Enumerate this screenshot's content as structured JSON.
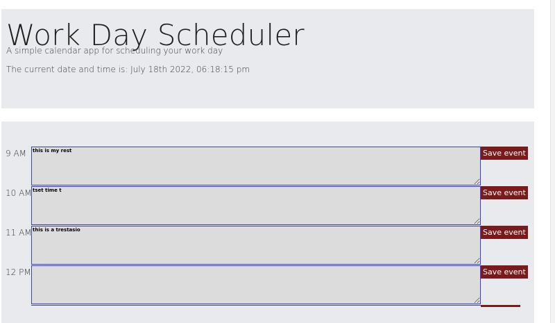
{
  "header": {
    "title": "Work Day Scheduler",
    "lead": "A simple calendar app for scheduling your work day",
    "current_time": "The current date and time is: July 18th 2022, 06:18:15 pm"
  },
  "rows": [
    {
      "hour": "9 AM",
      "text": "this is my rest",
      "save_label": "Save event"
    },
    {
      "hour": "10 AM",
      "text": "tset time t",
      "save_label": "Save event"
    },
    {
      "hour": "11 AM",
      "text": "this is a trestasio",
      "save_label": "Save event"
    },
    {
      "hour": "12 PM",
      "text": "",
      "save_label": "Save event"
    }
  ],
  "colors": {
    "panel_bg": "#e9eaee",
    "textarea_bg": "#dcdcdc",
    "textarea_border": "#3c3cd6",
    "save_button_bg": "#7b1a1a",
    "save_button_text": "#ffffff"
  },
  "icons": {
    "textarea_resize": "resize-grip-icon"
  }
}
